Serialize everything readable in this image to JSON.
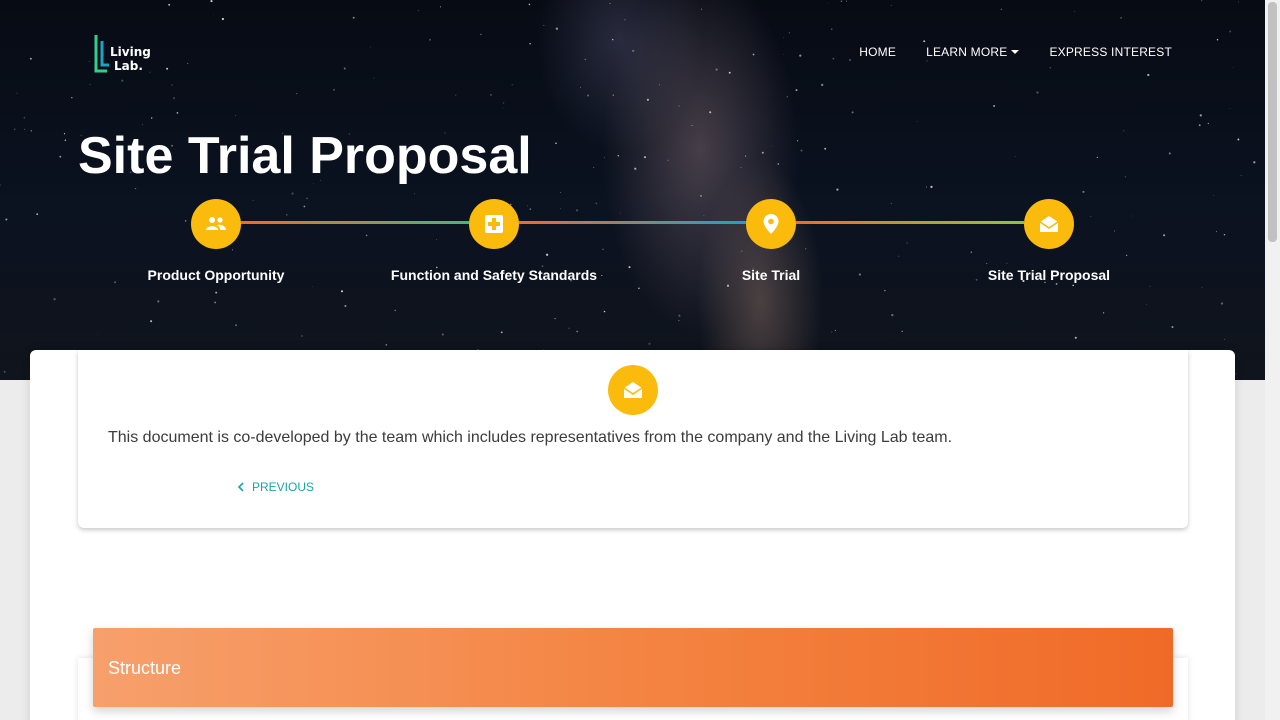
{
  "brand": {
    "line1": "Living",
    "line2": "Lab."
  },
  "nav": {
    "items": [
      {
        "label": "HOME"
      },
      {
        "label": "LEARN MORE"
      },
      {
        "label": "EXPRESS INTEREST"
      }
    ]
  },
  "page": {
    "title": "Site Trial Proposal"
  },
  "timeline": {
    "steps": [
      {
        "label": "Product Opportunity",
        "icon": "people-icon"
      },
      {
        "label": "Function and Safety Standards",
        "icon": "medical-cross-icon"
      },
      {
        "label": "Site Trial",
        "icon": "map-pin-icon"
      },
      {
        "label": "Site Trial Proposal",
        "icon": "open-envelope-icon"
      }
    ]
  },
  "card": {
    "icon": "open-envelope-icon",
    "text": "This document is co-developed by the team which includes representatives from the company and the Living Lab team.",
    "previous_label": "PREVIOUS"
  },
  "section": {
    "title": "Structure"
  },
  "colors": {
    "accent": "#fbbb0c",
    "link": "#1aa3a7",
    "banner_start": "#f7a06c",
    "banner_end": "#f06a27"
  }
}
